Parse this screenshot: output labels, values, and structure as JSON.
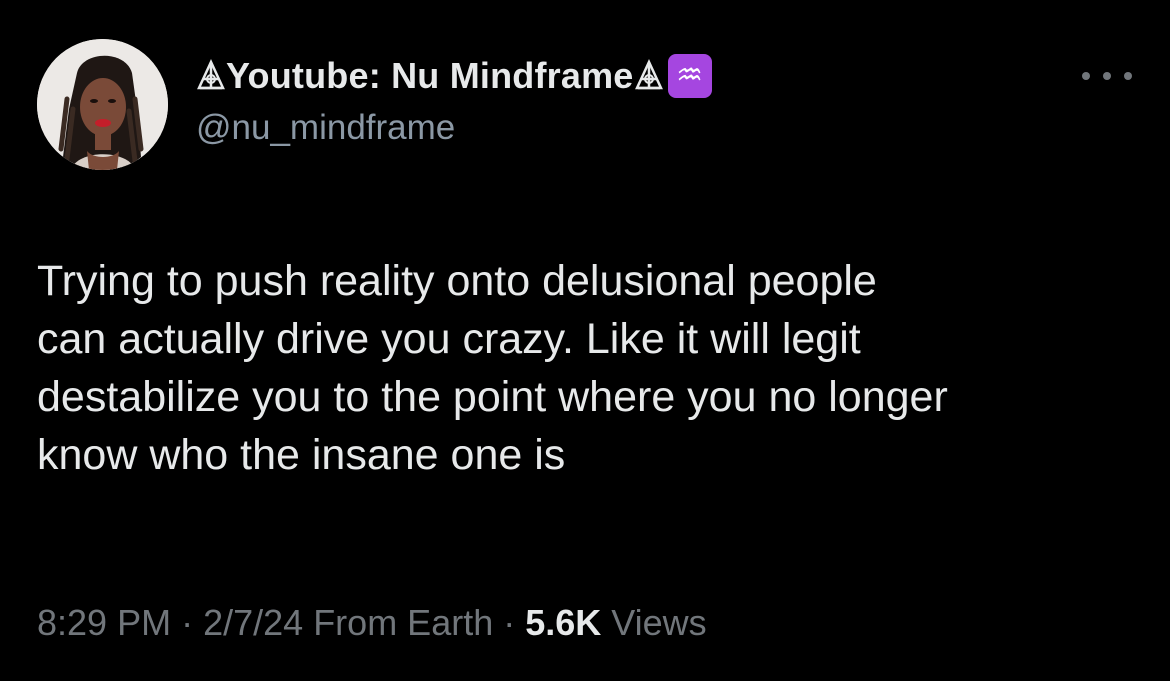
{
  "author": {
    "display_name": "Youtube: Nu Mindframe",
    "name_decoration_icon": "triangle-symbol-icon",
    "zodiac_badge": "♒",
    "zodiac_badge_icon": "aquarius-icon",
    "handle": "@nu_mindframe",
    "avatar_icon": "profile-photo"
  },
  "tweet": {
    "text_lines": [
      "Trying to push reality onto delusional people",
      "can actually drive you crazy. Like it will legit",
      "destabilize you to the point where you no longer",
      "know who the insane one is"
    ]
  },
  "meta": {
    "time": "8:29 PM",
    "date": "2/7/24",
    "source": "From Earth",
    "separator": "·",
    "views_count": "5.6K",
    "views_label": "Views"
  },
  "colors": {
    "background": "#000000",
    "primary_text": "#e7e9ea",
    "secondary_text": "#71767b",
    "badge": "#a546e0"
  }
}
